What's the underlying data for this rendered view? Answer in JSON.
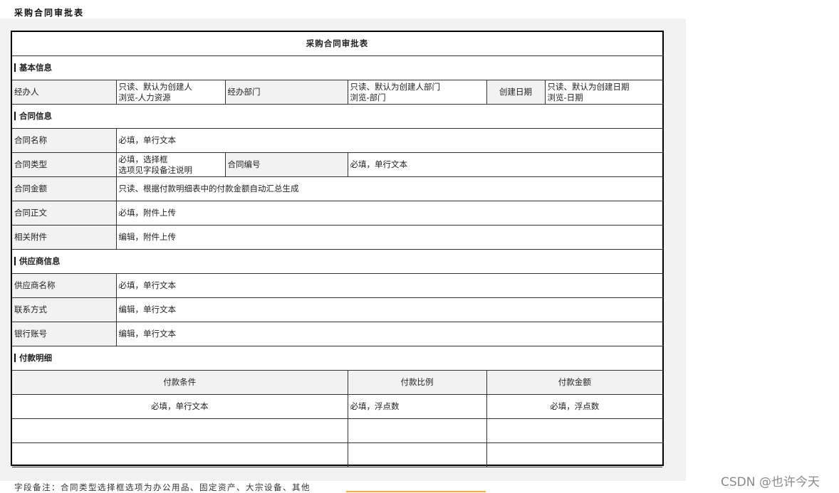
{
  "caption": "采购合同审批表",
  "title": "采购合同审批表",
  "sections": {
    "basic": "基本信息",
    "contract": "合同信息",
    "supplier": "供应商信息",
    "payment": "付款明细"
  },
  "basic": {
    "handler_label": "经办人",
    "handler_value": [
      "只读、默认为创建人",
      "浏览-人力资源"
    ],
    "dept_label": "经办部门",
    "dept_value": [
      "只读、默认为创建人部门",
      "浏览-部门"
    ],
    "date_label": "创建日期",
    "date_value": [
      "只读、默认为创建日期",
      "浏览-日期"
    ]
  },
  "contract": {
    "name_label": "合同名称",
    "name_value": "必填，单行文本",
    "type_label": "合同类型",
    "type_value": [
      "必填，选择框",
      "选项见字段备注说明"
    ],
    "number_label": "合同编号",
    "number_value": "必填，单行文本",
    "amount_label": "合同金额",
    "amount_value": "只读、根据付款明细表中的付款金额自动汇总生成",
    "body_label": "合同正文",
    "body_value": "必填，附件上传",
    "attach_label": "相关附件",
    "attach_value": "编辑，附件上传"
  },
  "supplier": {
    "name_label": "供应商名称",
    "name_value": "必填，单行文本",
    "contact_label": "联系方式",
    "contact_value": "编辑，单行文本",
    "account_label": "银行账号",
    "account_value": "编辑，单行文本"
  },
  "payment": {
    "headers": [
      "付款条件",
      "付款比例",
      "付款金额"
    ],
    "rows": [
      [
        "必填，单行文本",
        "必填，浮点数",
        "必填，浮点数"
      ],
      [
        "",
        "",
        ""
      ],
      [
        "",
        "",
        ""
      ]
    ]
  },
  "footer_note": "字段备注：合同类型选择框选项为办公用品、固定资产、大宗设备、其他",
  "watermark": "CSDN @也许今天"
}
